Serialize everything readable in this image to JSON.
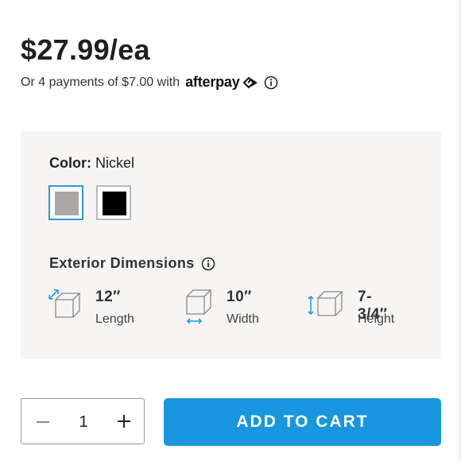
{
  "price": {
    "amount": "$27.99/ea",
    "installments_text": "Or 4 payments of $7.00 with",
    "provider": "afterpay"
  },
  "color": {
    "label": "Color:",
    "selected": "Nickel",
    "swatches": [
      {
        "name": "Nickel",
        "hex": "#aaa8a4",
        "selected": true
      },
      {
        "name": "Black",
        "hex": "#000000",
        "selected": false
      }
    ]
  },
  "dimensions": {
    "heading": "Exterior Dimensions",
    "items": [
      {
        "value": "12″",
        "label": "Length",
        "icon": "cube-length-icon"
      },
      {
        "value": "10″",
        "label": "Width",
        "icon": "cube-width-icon"
      },
      {
        "value": "7-3/4″",
        "label": "Height",
        "icon": "cube-height-icon"
      }
    ]
  },
  "cart": {
    "quantity": "1",
    "button_label": "ADD TO CART",
    "accent_color": "#1996e0"
  }
}
